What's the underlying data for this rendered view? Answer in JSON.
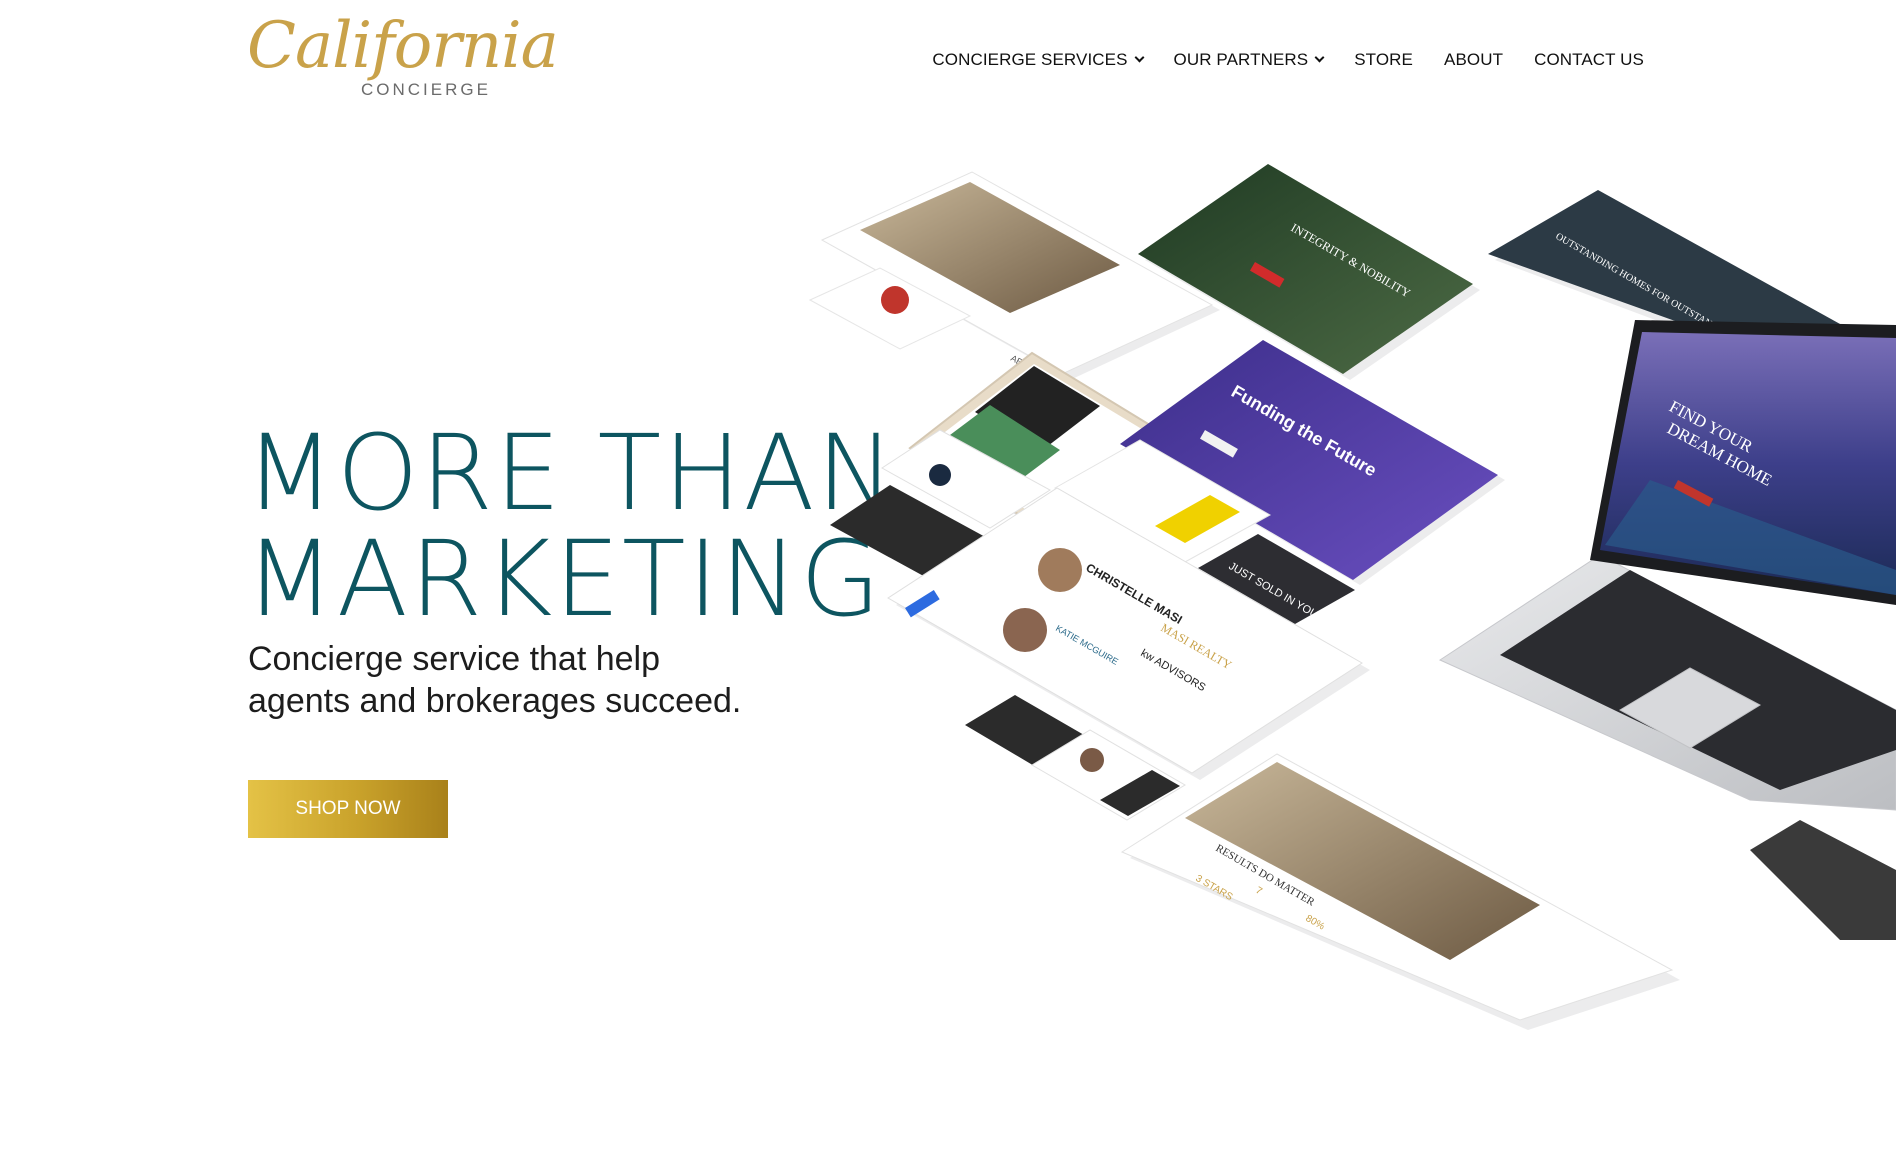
{
  "logo": {
    "script": "California",
    "sub": "CONCIERGE"
  },
  "nav": {
    "items": [
      {
        "label": "CONCIERGE SERVICES",
        "has_dropdown": true
      },
      {
        "label": "OUR PARTNERS",
        "has_dropdown": true
      },
      {
        "label": "STORE",
        "has_dropdown": false
      },
      {
        "label": "ABOUT",
        "has_dropdown": false
      },
      {
        "label": "CONTACT US",
        "has_dropdown": false
      }
    ]
  },
  "hero": {
    "title_line1": "MORE THAN",
    "title_line2": "MARKETING",
    "subtitle_line1": "Concierge service that help",
    "subtitle_line2": "agents and brokerages succeed.",
    "cta_label": "SHOP NOW"
  },
  "collage": {
    "laptop_text_1": "FIND YOUR",
    "laptop_text_2": "DREAM HOME",
    "funding_text": "Funding the Future",
    "integrity_text": "INTEGRITY & NOBILITY",
    "results_text": "RESULTS DO MATTER",
    "masi_text": "MASI REALTY",
    "christelle_text": "CHRISTELLE MASI",
    "katie_text": "KATIE MCGUIRE",
    "kw_text": "kw ADVISORS",
    "just_sold_text": "JUST SOLD IN YOUR NEIGHBORHOOD",
    "outstanding_text": "OUTSTANDING HOMES FOR OUTSTANDING PEOPLE",
    "about_text": "ABOUT ELYSE",
    "results_stat_1": "3 STARS",
    "results_stat_2": "7",
    "results_stat_3": "80%"
  },
  "colors": {
    "title": "#0d5560",
    "gold": "#c9a24a",
    "button_start": "#e4c246",
    "button_end": "#a9811a",
    "nav_text": "#111111"
  }
}
